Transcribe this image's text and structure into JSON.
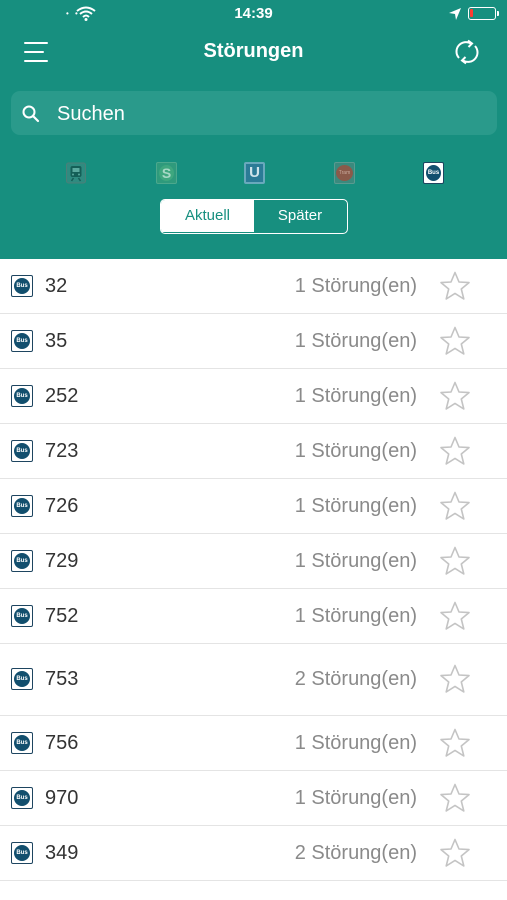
{
  "status_bar": {
    "time": "14:39"
  },
  "nav": {
    "title": "Störungen"
  },
  "search": {
    "placeholder": "Suchen"
  },
  "transport_filters": [
    {
      "name": "regional-train",
      "label": ""
    },
    {
      "name": "s-bahn",
      "label": "S"
    },
    {
      "name": "u-bahn",
      "label": "U"
    },
    {
      "name": "tram",
      "label": "Tram"
    },
    {
      "name": "bus",
      "label": "Bus",
      "selected": true
    }
  ],
  "segments": {
    "active": "Aktuell",
    "inactive": "Später"
  },
  "list": {
    "icon_label": "Bus",
    "rows": [
      {
        "line": "32",
        "count": "1 Störung(en)"
      },
      {
        "line": "35",
        "count": "1 Störung(en)"
      },
      {
        "line": "252",
        "count": "1 Störung(en)"
      },
      {
        "line": "723",
        "count": "1 Störung(en)"
      },
      {
        "line": "726",
        "count": "1 Störung(en)"
      },
      {
        "line": "729",
        "count": "1 Störung(en)"
      },
      {
        "line": "752",
        "count": "1 Störung(en)"
      },
      {
        "line": "753",
        "count": "2 Störung(en)"
      },
      {
        "line": "756",
        "count": "1 Störung(en)"
      },
      {
        "line": "970",
        "count": "1 Störung(en)"
      },
      {
        "line": "349",
        "count": "2 Störung(en)"
      }
    ]
  },
  "colors": {
    "primary": "#178f7f",
    "search_bg": "#2a9a8b",
    "bus_icon": "#124f6e",
    "star": "#c4c4c4"
  }
}
